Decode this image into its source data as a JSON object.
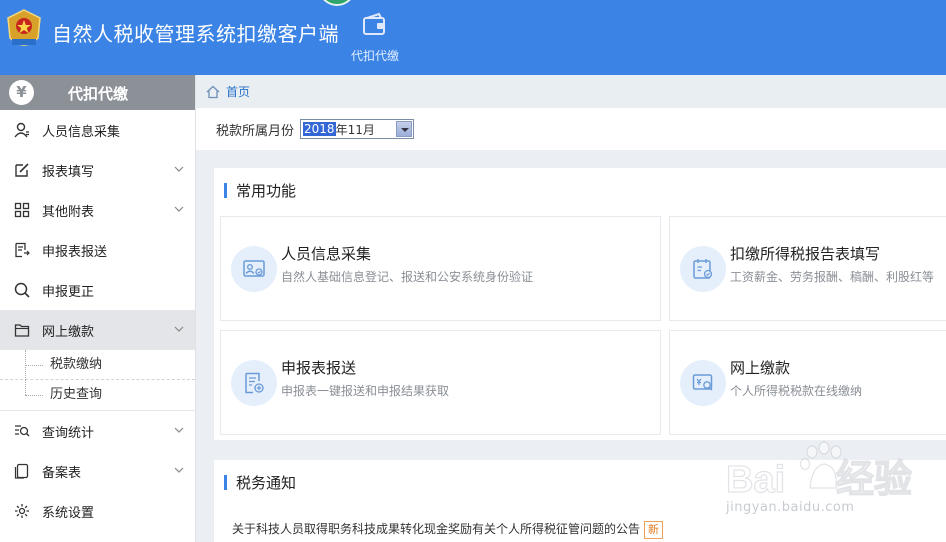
{
  "header": {
    "app_title": "自然人税收管理系统扣缴客户端",
    "tabs": [
      {
        "label": "代扣代缴",
        "icon": "wallet-icon"
      }
    ]
  },
  "sidebar": {
    "head_label": "代扣代缴",
    "head_icon": "yen-icon",
    "items": [
      {
        "label": "人员信息采集",
        "icon": "person-icon",
        "expandable": false
      },
      {
        "label": "报表填写",
        "icon": "edit-icon",
        "expandable": true
      },
      {
        "label": "其他附表",
        "icon": "grid-icon",
        "expandable": true
      },
      {
        "label": "申报表报送",
        "icon": "form-send-icon",
        "expandable": false
      },
      {
        "label": "申报更正",
        "icon": "search-icon",
        "expandable": false
      },
      {
        "label": "网上缴款",
        "icon": "folder-icon",
        "expandable": true,
        "active": true,
        "children": [
          {
            "label": "税款缴纳"
          },
          {
            "label": "历史查询"
          }
        ]
      },
      {
        "label": "查询统计",
        "icon": "query-stats-icon",
        "expandable": true
      },
      {
        "label": "备案表",
        "icon": "copy-icon",
        "expandable": true
      },
      {
        "label": "系统设置",
        "icon": "gear-icon",
        "expandable": false
      }
    ]
  },
  "breadcrumb": {
    "home_label": "首页"
  },
  "month_bar": {
    "label": "税款所属月份",
    "value_highlight": "2018",
    "value_rest": "年11月"
  },
  "common": {
    "title": "常用功能",
    "cards": [
      {
        "title": "人员信息采集",
        "desc": "自然人基础信息登记、报送和公安系统身份验证",
        "icon": "id-card-icon"
      },
      {
        "title": "扣缴所得税报告表填写",
        "desc": "工资薪金、劳务报酬、稿酬、利股红等",
        "icon": "calendar-form-icon"
      },
      {
        "title": "申报表报送",
        "desc": "申报表一键报送和申报结果获取",
        "icon": "form-upload-icon"
      },
      {
        "title": "网上缴款",
        "desc": "个人所得税税款在线缴纳",
        "icon": "payment-icon"
      }
    ]
  },
  "notice": {
    "title": "税务通知",
    "items": [
      {
        "text": "关于科技人员取得职务科技成果转化现金奖励有关个人所得税征管问题的公告",
        "badge": "新"
      }
    ]
  },
  "watermark": {
    "text": "jingyan.baidu.com"
  },
  "colors": {
    "header": "#3b84e6",
    "sidebar_head": "#8c9097",
    "accent": "#3b84e6",
    "link": "#2a73c8",
    "badge": "#e07a1e"
  }
}
